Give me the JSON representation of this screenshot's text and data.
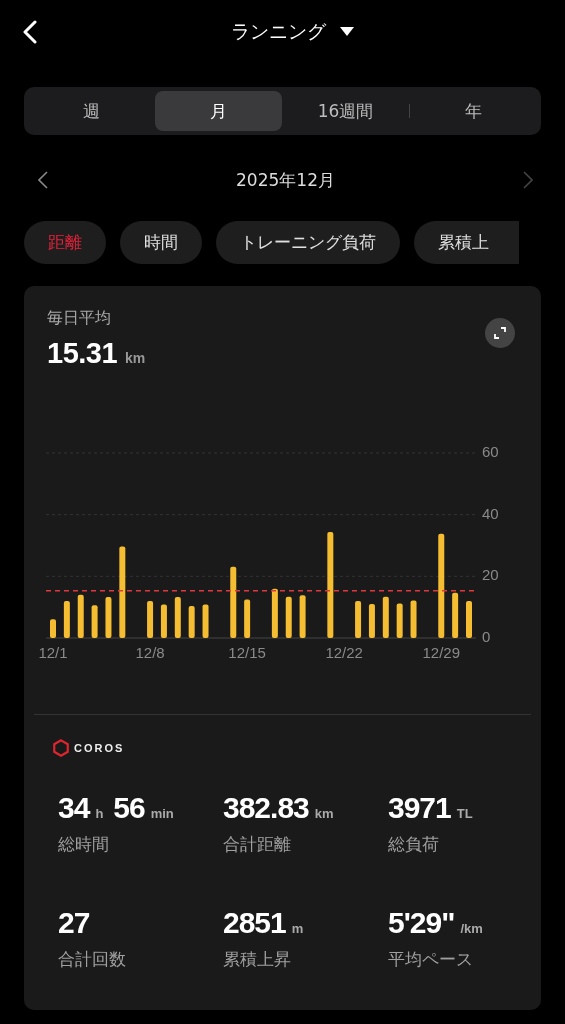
{
  "header": {
    "title": "ランニング"
  },
  "period_tabs": [
    {
      "label": "週",
      "selected": false
    },
    {
      "label": "月",
      "selected": true
    },
    {
      "label": "16週間",
      "selected": false
    },
    {
      "label": "年",
      "selected": false
    }
  ],
  "date_nav": {
    "label": "2025年12月"
  },
  "metric_chips": [
    {
      "label": "距離",
      "selected": true
    },
    {
      "label": "時間",
      "selected": false
    },
    {
      "label": "トレーニング負荷",
      "selected": false
    },
    {
      "label": "累積上",
      "selected": false
    }
  ],
  "summary": {
    "label": "毎日平均",
    "value": "15.31",
    "unit": "km"
  },
  "chart_data": {
    "type": "bar",
    "categories": [
      "12/1",
      null,
      null,
      null,
      null,
      null,
      null,
      "12/8",
      null,
      null,
      null,
      null,
      null,
      null,
      "12/15",
      null,
      null,
      null,
      null,
      null,
      null,
      "12/22",
      null,
      null,
      null,
      null,
      null,
      null,
      "12/29",
      null,
      null
    ],
    "series": [
      {
        "color": "#f5bd32",
        "values": [
          6.1,
          12,
          14,
          10.6,
          13.3,
          29.7,
          null,
          12,
          10.9,
          13.3,
          10.4,
          10.9,
          null,
          23.1,
          12.5,
          null,
          16,
          13.4,
          13.9,
          null,
          34.4,
          null,
          12,
          11,
          13.4,
          11.2,
          12.2,
          null,
          33.8,
          14.7,
          12
        ]
      }
    ],
    "ylim": [
      0,
      60
    ],
    "yticks": [
      0,
      20,
      40,
      60
    ],
    "ref_lines": [
      {
        "axis": "y",
        "value": 15.31
      }
    ]
  },
  "brand": {
    "name": "COROS"
  },
  "stats": [
    {
      "parts": [
        {
          "number": "34",
          "unit": "h"
        },
        {
          "number": "56",
          "unit": "min"
        }
      ],
      "label": "総時間"
    },
    {
      "parts": [
        {
          "number": "382.83",
          "unit": "km"
        }
      ],
      "label": "合計距離"
    },
    {
      "parts": [
        {
          "number": "3971",
          "unit": "TL"
        }
      ],
      "label": "総負荷"
    },
    {
      "parts": [
        {
          "number": "27"
        }
      ],
      "label": "合計回数"
    },
    {
      "parts": [
        {
          "number": "2851",
          "unit": "m"
        }
      ],
      "label": "累積上昇"
    },
    {
      "parts": [
        {
          "number": "5'29\"",
          "unit": "/km"
        }
      ],
      "label": "平均ペース"
    }
  ]
}
